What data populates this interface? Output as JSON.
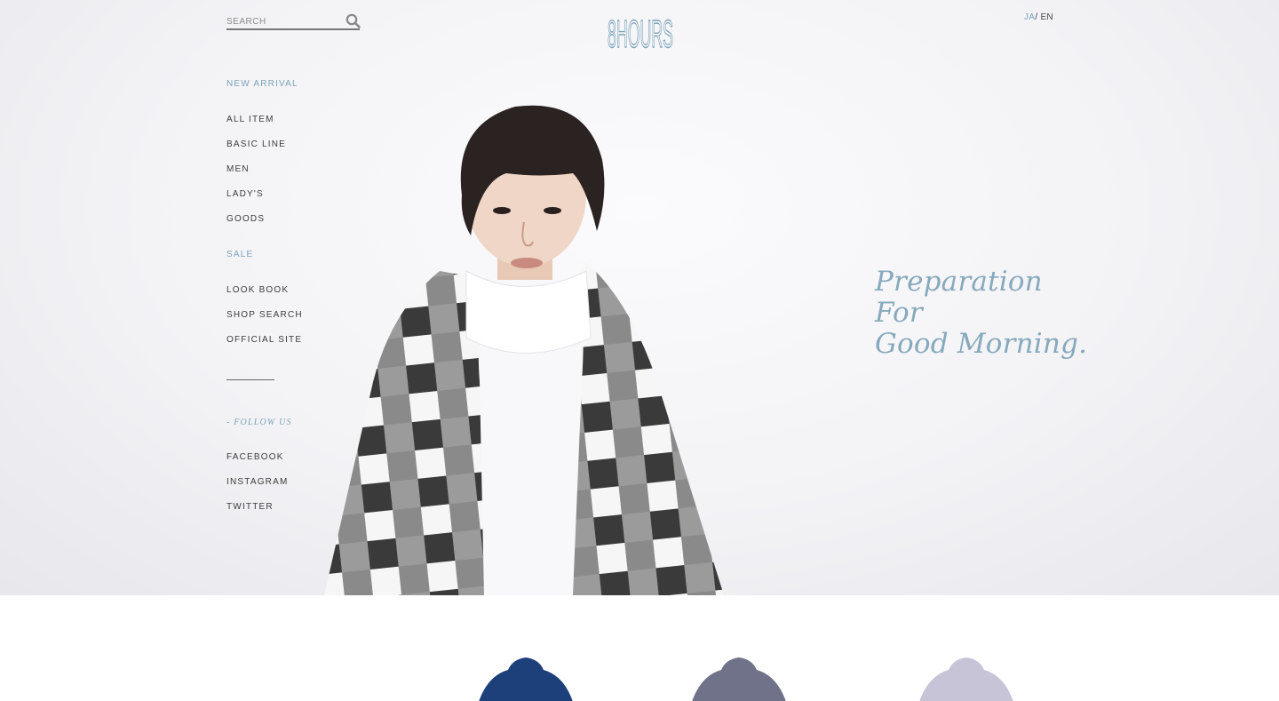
{
  "brand": {
    "logo_text": "8HOURS"
  },
  "search": {
    "placeholder": "SEARCH"
  },
  "language": {
    "ja": "JA",
    "separator": "/",
    "en": " EN"
  },
  "nav": {
    "new_arrival": "NEW ARRIVAL",
    "items": [
      "ALL ITEM",
      "BASIC LINE",
      "MEN",
      "LADY'S",
      "GOODS"
    ],
    "sale": "SALE",
    "links": [
      "LOOK BOOK",
      "SHOP SEARCH",
      "OFFICIAL SITE"
    ],
    "follow_heading": "- FOLLOW US",
    "social": [
      "FACEBOOK",
      "INSTAGRAM",
      "TWITTER"
    ]
  },
  "hero": {
    "tagline": [
      "Preparation",
      "For",
      "Good Morning."
    ]
  },
  "products": [
    {
      "name": "navy-turtleneck",
      "color": "#1d3f7a"
    },
    {
      "name": "grey-turtleneck",
      "color": "#6f7288"
    },
    {
      "name": "lavender-turtleneck",
      "color": "#c8c4d8"
    }
  ],
  "colors": {
    "accent": "#7ba2b8",
    "tagline": "#86a9bc",
    "text": "#3c3c3c"
  }
}
